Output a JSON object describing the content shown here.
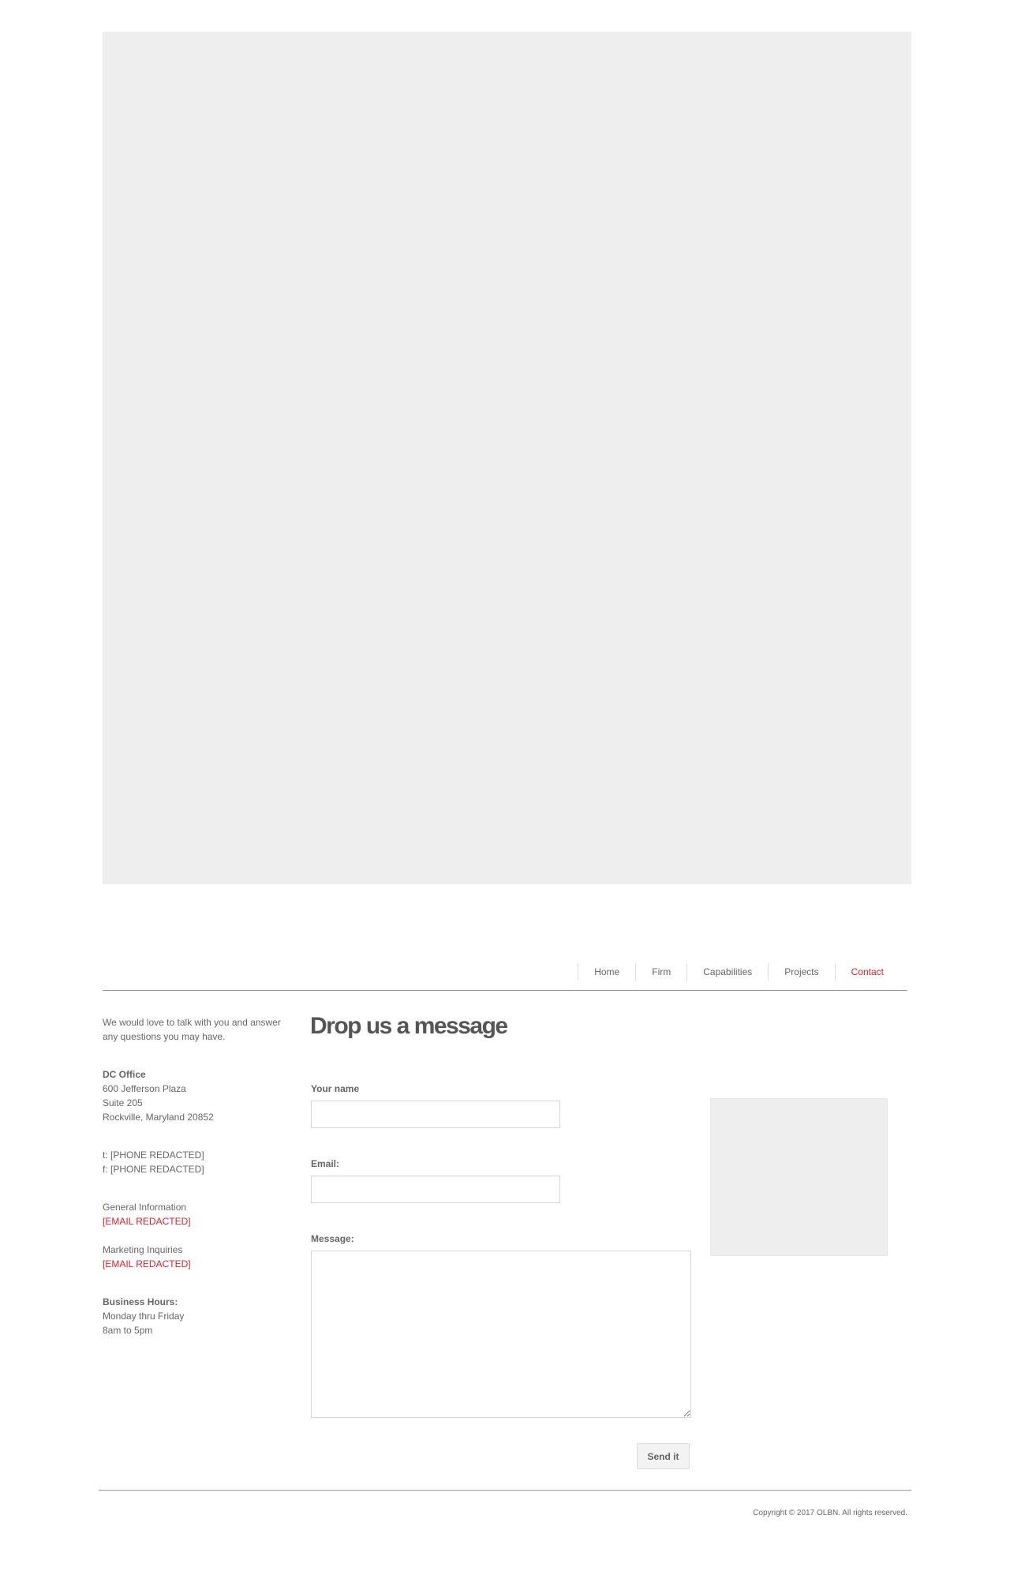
{
  "nav": {
    "items": [
      {
        "label": "Home",
        "active": false
      },
      {
        "label": "Firm",
        "active": false
      },
      {
        "label": "Capabilities",
        "active": false
      },
      {
        "label": "Projects",
        "active": false
      },
      {
        "label": "Contact",
        "active": true
      }
    ],
    "accent_color": "#e0212e"
  },
  "sidebar": {
    "intro_line1": "We would love to talk with you and answer",
    "intro_line2": "any questions you may have.",
    "office_title": "DC Office",
    "address_line1": "600 Jefferson Plaza",
    "address_line2": "Suite 205",
    "address_line3": "Rockville, Maryland 20852",
    "phone": "t: [PHONE REDACTED]",
    "fax": "f: [PHONE REDACTED]",
    "general_label": "General Information",
    "general_email": "[EMAIL REDACTED]",
    "marketing_label": "Marketing Inquiries",
    "marketing_email": "[EMAIL REDACTED]",
    "hours_title": "Business Hours:",
    "hours_days": "Monday thru Friday",
    "hours_time": "8am to 5pm"
  },
  "form": {
    "title": "Drop us a message",
    "name_label": "Your name",
    "name_value": "",
    "email_label": "Email:",
    "email_value": "",
    "message_label": "Message:",
    "message_value": "",
    "submit_label": "Send it"
  },
  "footer": {
    "copyright": "Copyright © 2017 OLBN. All rights reserved."
  }
}
